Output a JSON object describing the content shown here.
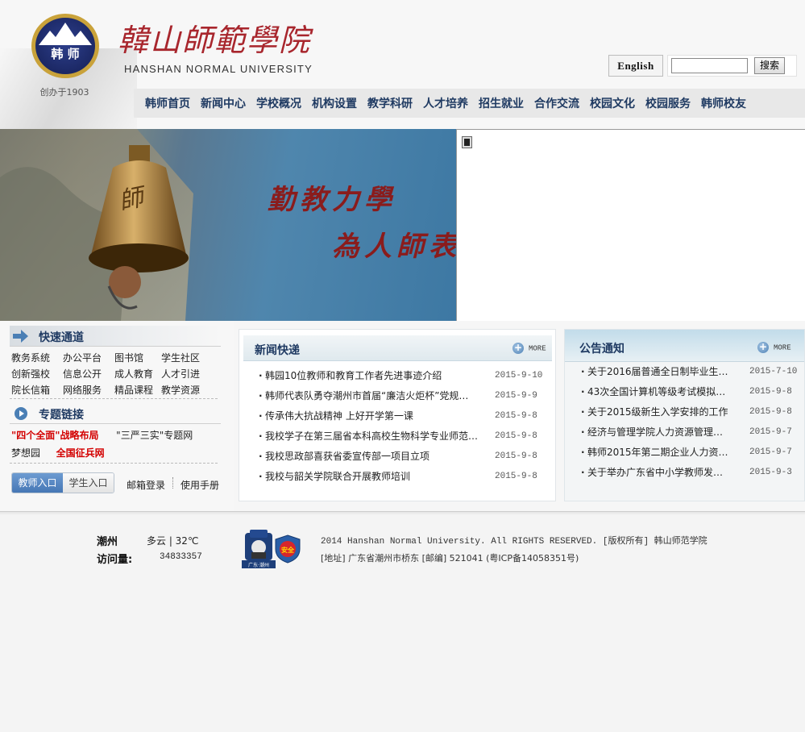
{
  "header": {
    "seal_text": "韩 师",
    "founded": "创办于1903",
    "logo_cn": "韓山師範學院",
    "logo_en": "HANSHAN NORMAL UNIVERSITY",
    "lang_button": "English",
    "search_placeholder": "",
    "search_button": "搜索"
  },
  "nav": [
    "韩师首页",
    "新闻中心",
    "学校概况",
    "机构设置",
    "教学科研",
    "人才培养",
    "招生就业",
    "合作交流",
    "校园文化",
    "校园服务",
    "韩师校友"
  ],
  "banner": {
    "motto_1": "勤教力學",
    "motto_2": "為人師表"
  },
  "quick_access": {
    "title": "快速通道",
    "links": [
      "教务系统",
      "办公平台",
      "图书馆",
      "学生社区",
      "创新强校",
      "信息公开",
      "成人教育",
      "人才引进",
      "院长信箱",
      "网络服务",
      "精品课程",
      "教学资源"
    ]
  },
  "topics": {
    "title": "专题链接",
    "row1_a": "\"四个全面\"战略布局",
    "row1_b": "\"三严三实\"专题网",
    "row2_a": "梦想园",
    "row2_b": "全国征兵网"
  },
  "login": {
    "teacher": "教师入口",
    "student": "学生入口",
    "mail": "邮箱登录",
    "manual": "使用手册"
  },
  "news": {
    "title": "新闻快递",
    "more": "MORE",
    "items": [
      {
        "title": "韩园10位教师和教育工作者先进事迹介绍",
        "date": "2015-9-10"
      },
      {
        "title": "韩师代表队勇夺潮州市首届“廉洁火炬杯”党规…",
        "date": "2015-9-9"
      },
      {
        "title": "传承伟大抗战精神 上好开学第一课",
        "date": "2015-9-8"
      },
      {
        "title": "我校学子在第三届省本科高校生物科学专业师范…",
        "date": "2015-9-8"
      },
      {
        "title": "我校思政部喜获省委宣传部一项目立项",
        "date": "2015-9-8"
      },
      {
        "title": "我校与韶关学院联合开展教师培训",
        "date": "2015-9-8"
      }
    ]
  },
  "notice": {
    "title": "公告通知",
    "more": "MORE",
    "items": [
      {
        "title": "关于2016届普通全日制毕业生…",
        "date": "2015-7-10"
      },
      {
        "title": "43次全国计算机等级考试模拟…",
        "date": "2015-9-8"
      },
      {
        "title": "关于2015级新生入学安排的工作",
        "date": "2015-9-8"
      },
      {
        "title": "经济与管理学院人力资源管理…",
        "date": "2015-9-7"
      },
      {
        "title": "韩师2015年第二期企业人力资…",
        "date": "2015-9-7"
      },
      {
        "title": "关于举办广东省中小学教师发…",
        "date": "2015-9-3"
      }
    ]
  },
  "footer": {
    "city": "潮州",
    "weather": "多云 | 32℃",
    "visits_label": "访问量:",
    "visits": "34833357",
    "police_label": "广东·潮州",
    "shield_label": "安全",
    "copyright": "2014 Hanshan Normal University. All RIGHTS RESERVED. [版权所有] 韩山师范学院",
    "address": "[地址] 广东省潮州市桥东 [邮编] 521041 (粤ICP备14058351号)"
  },
  "colors": {
    "nav_text": "#1f3a62",
    "logo_red": "#a8262d",
    "topic_red": "#d30000",
    "teacher_tab": "#4677b5"
  },
  "icons": [
    "seal-logo-icon",
    "search-icon",
    "arrow-right-icon",
    "play-circle-icon",
    "plus-more-icon",
    "media-icon",
    "police-badge-icon",
    "shield-icon"
  ]
}
